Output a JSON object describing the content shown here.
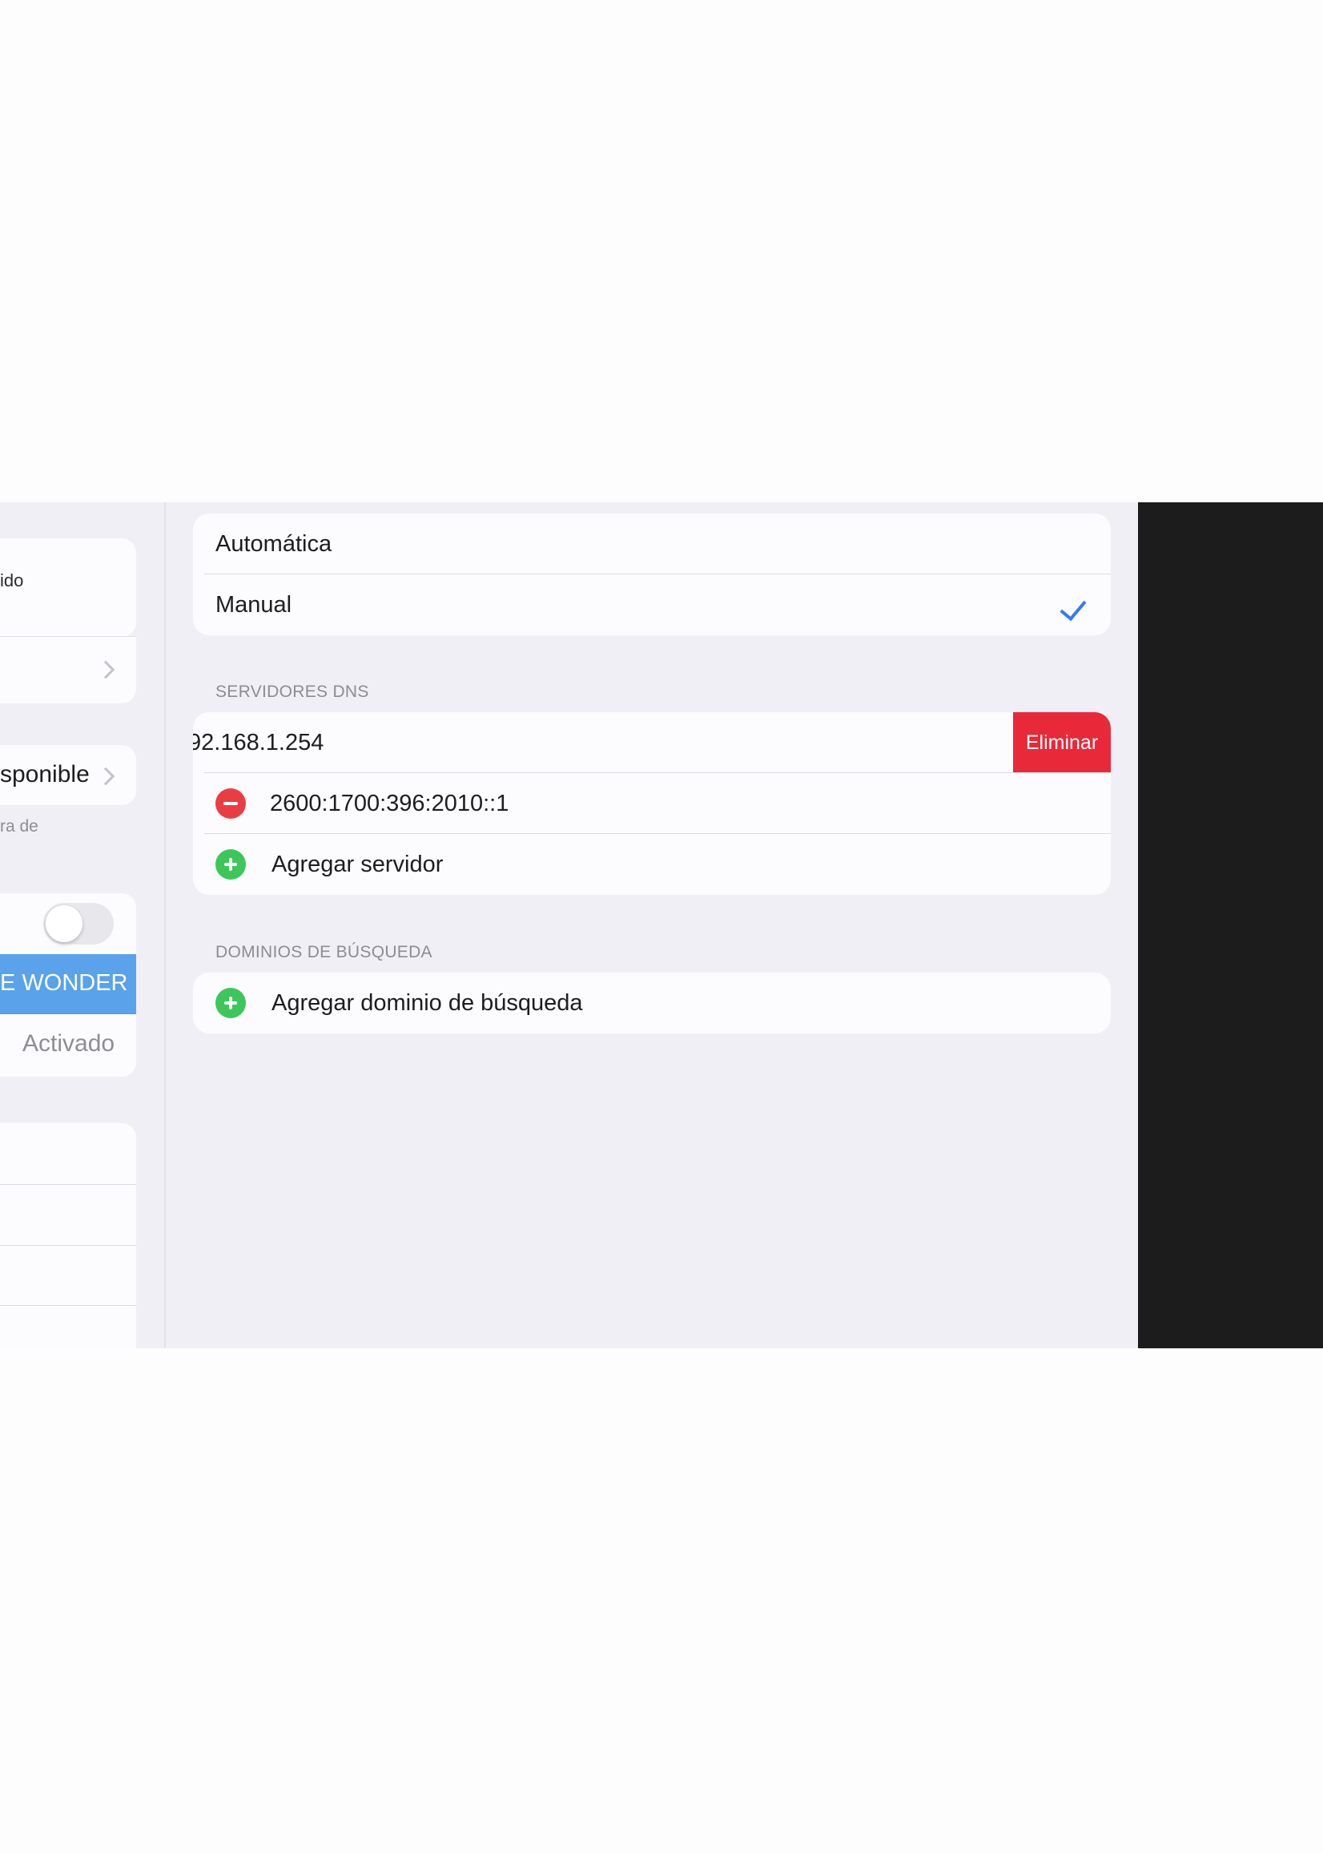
{
  "sidebar": {
    "partial_item_1": "ido",
    "partial_item_3": "sponible",
    "partial_note": "ra de",
    "selected_network": "E WONDER",
    "status_value": "Activado"
  },
  "dns_mode": {
    "options": [
      {
        "label": "Automática",
        "selected": false
      },
      {
        "label": "Manual",
        "selected": true
      }
    ]
  },
  "dns_servers": {
    "header": "SERVIDORES DNS",
    "swiped_server": "92.168.1.254",
    "delete_label": "Eliminar",
    "server_2": "2600:1700:396:2010::1",
    "add_label": "Agregar servidor"
  },
  "search_domains": {
    "header": "DOMINIOS DE BÚSQUEDA",
    "add_label": "Agregar dominio de búsqueda"
  },
  "colors": {
    "accent": "#2f7cf6",
    "delete": "#e8293a",
    "add": "#3dc75b",
    "remove": "#ea3d42",
    "selected_row": "#5aa2ea"
  }
}
